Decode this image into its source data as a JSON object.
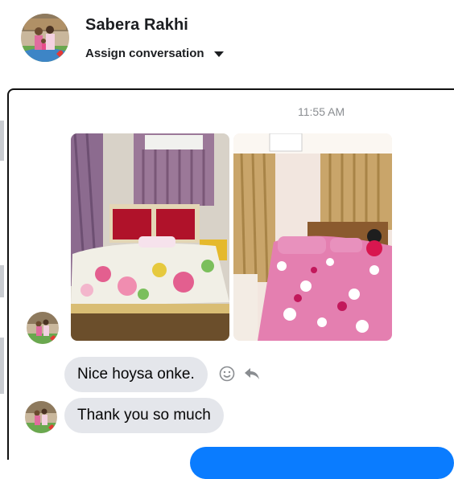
{
  "contact": {
    "name": "Sabera Rakhi",
    "assign_label": "Assign conversation"
  },
  "icons": {
    "avatar": "contact-avatar",
    "assign_caret": "caret-down-icon",
    "react": "smiley-icon",
    "reply": "reply-arrow-icon"
  },
  "conversation": {
    "timestamp": "11:55 AM",
    "photos": [
      {
        "name": "bedroom-photo-1",
        "subject": "bed with red headboard and floral sheet"
      },
      {
        "name": "bedroom-photo-2",
        "subject": "bed with pink floral sheet and teddy"
      }
    ],
    "messages": [
      {
        "text": "Nice hoysa onke.",
        "from": "contact"
      },
      {
        "text": "Thank you so much",
        "from": "contact"
      }
    ]
  },
  "colors": {
    "incoming_bubble": "#e4e6eb",
    "outgoing_bubble": "#0a7cff",
    "timestamp": "#8a8d91"
  }
}
